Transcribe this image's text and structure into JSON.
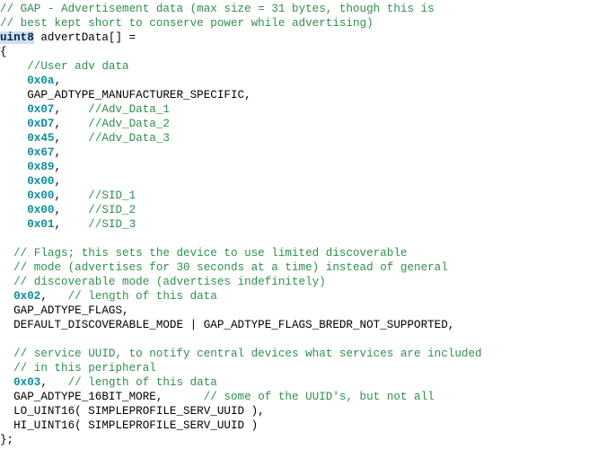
{
  "editor": {
    "name": "c-source-code-view",
    "language": "C",
    "background_color": "#ffffff",
    "colors": {
      "comment": "#2f8f4f",
      "number": "#0f8d99",
      "identifier": "#000000",
      "keyword": "#10243f",
      "keyword_highlight_background": "#cfe0f2"
    },
    "lines": [
      {
        "index": 1,
        "tokens": [
          {
            "type": "comment",
            "text": "// GAP - Advertisement data (max size = 31 bytes, though this is"
          }
        ]
      },
      {
        "index": 2,
        "tokens": [
          {
            "type": "comment",
            "text": "// best kept short to conserve power while advertising)"
          }
        ]
      },
      {
        "index": 3,
        "tokens": [
          {
            "type": "keyword",
            "text": "uint8"
          },
          {
            "type": "plain",
            "text": " advertData[] ="
          }
        ]
      },
      {
        "index": 4,
        "tokens": [
          {
            "type": "punct",
            "text": "{"
          }
        ]
      },
      {
        "index": 5,
        "tokens": [
          {
            "type": "comment",
            "text": "    //User adv data"
          }
        ]
      },
      {
        "index": 6,
        "tokens": [
          {
            "type": "plain",
            "text": "    "
          },
          {
            "type": "number",
            "text": "0x0a"
          },
          {
            "type": "punct",
            "text": ","
          }
        ]
      },
      {
        "index": 7,
        "tokens": [
          {
            "type": "plain",
            "text": "    GAP_ADTYPE_MANUFACTURER_SPECIFIC,"
          }
        ]
      },
      {
        "index": 8,
        "tokens": [
          {
            "type": "plain",
            "text": "    "
          },
          {
            "type": "number",
            "text": "0x07"
          },
          {
            "type": "punct",
            "text": ",    "
          },
          {
            "type": "comment",
            "text": "//Adv_Data_1"
          }
        ]
      },
      {
        "index": 9,
        "tokens": [
          {
            "type": "plain",
            "text": "    "
          },
          {
            "type": "number",
            "text": "0xD7"
          },
          {
            "type": "punct",
            "text": ",    "
          },
          {
            "type": "comment",
            "text": "//Adv_Data_2"
          }
        ]
      },
      {
        "index": 10,
        "tokens": [
          {
            "type": "plain",
            "text": "    "
          },
          {
            "type": "number",
            "text": "0x45"
          },
          {
            "type": "punct",
            "text": ",    "
          },
          {
            "type": "comment",
            "text": "//Adv_Data_3"
          }
        ]
      },
      {
        "index": 11,
        "tokens": [
          {
            "type": "plain",
            "text": "    "
          },
          {
            "type": "number",
            "text": "0x67"
          },
          {
            "type": "punct",
            "text": ","
          }
        ]
      },
      {
        "index": 12,
        "tokens": [
          {
            "type": "plain",
            "text": "    "
          },
          {
            "type": "number",
            "text": "0x89"
          },
          {
            "type": "punct",
            "text": ","
          }
        ]
      },
      {
        "index": 13,
        "tokens": [
          {
            "type": "plain",
            "text": "    "
          },
          {
            "type": "number",
            "text": "0x00"
          },
          {
            "type": "punct",
            "text": ","
          }
        ]
      },
      {
        "index": 14,
        "tokens": [
          {
            "type": "plain",
            "text": "    "
          },
          {
            "type": "number",
            "text": "0x00"
          },
          {
            "type": "punct",
            "text": ",    "
          },
          {
            "type": "comment",
            "text": "//SID_1"
          }
        ]
      },
      {
        "index": 15,
        "tokens": [
          {
            "type": "plain",
            "text": "    "
          },
          {
            "type": "number",
            "text": "0x00"
          },
          {
            "type": "punct",
            "text": ",    "
          },
          {
            "type": "comment",
            "text": "//SID_2"
          }
        ]
      },
      {
        "index": 16,
        "tokens": [
          {
            "type": "plain",
            "text": "    "
          },
          {
            "type": "number",
            "text": "0x01"
          },
          {
            "type": "punct",
            "text": ",    "
          },
          {
            "type": "comment",
            "text": "//SID_3"
          }
        ]
      },
      {
        "index": 17,
        "tokens": []
      },
      {
        "index": 18,
        "tokens": [
          {
            "type": "comment",
            "text": "  // Flags; this sets the device to use limited discoverable"
          }
        ]
      },
      {
        "index": 19,
        "tokens": [
          {
            "type": "comment",
            "text": "  // mode (advertises for 30 seconds at a time) instead of general"
          }
        ]
      },
      {
        "index": 20,
        "tokens": [
          {
            "type": "comment",
            "text": "  // discoverable mode (advertises indefinitely)"
          }
        ]
      },
      {
        "index": 21,
        "tokens": [
          {
            "type": "plain",
            "text": "  "
          },
          {
            "type": "number",
            "text": "0x02"
          },
          {
            "type": "punct",
            "text": ",   "
          },
          {
            "type": "comment",
            "text": "// length of this data"
          }
        ]
      },
      {
        "index": 22,
        "tokens": [
          {
            "type": "plain",
            "text": "  GAP_ADTYPE_FLAGS,"
          }
        ]
      },
      {
        "index": 23,
        "tokens": [
          {
            "type": "plain",
            "text": "  DEFAULT_DISCOVERABLE_MODE | GAP_ADTYPE_FLAGS_BREDR_NOT_SUPPORTED,"
          }
        ]
      },
      {
        "index": 24,
        "tokens": []
      },
      {
        "index": 25,
        "tokens": [
          {
            "type": "comment",
            "text": "  // service UUID, to notify central devices what services are included"
          }
        ]
      },
      {
        "index": 26,
        "tokens": [
          {
            "type": "comment",
            "text": "  // in this peripheral"
          }
        ]
      },
      {
        "index": 27,
        "tokens": [
          {
            "type": "plain",
            "text": "  "
          },
          {
            "type": "number",
            "text": "0x03"
          },
          {
            "type": "punct",
            "text": ",   "
          },
          {
            "type": "comment",
            "text": "// length of this data"
          }
        ]
      },
      {
        "index": 28,
        "tokens": [
          {
            "type": "plain",
            "text": "  GAP_ADTYPE_16BIT_MORE,      "
          },
          {
            "type": "comment",
            "text": "// some of the UUID's, but not all"
          }
        ]
      },
      {
        "index": 29,
        "tokens": [
          {
            "type": "plain",
            "text": "  LO_UINT16( SIMPLEPROFILE_SERV_UUID ),"
          }
        ]
      },
      {
        "index": 30,
        "tokens": [
          {
            "type": "plain",
            "text": "  HI_UINT16( SIMPLEPROFILE_SERV_UUID )"
          }
        ]
      },
      {
        "index": 31,
        "tokens": [
          {
            "type": "punct",
            "text": "};"
          }
        ]
      }
    ]
  }
}
